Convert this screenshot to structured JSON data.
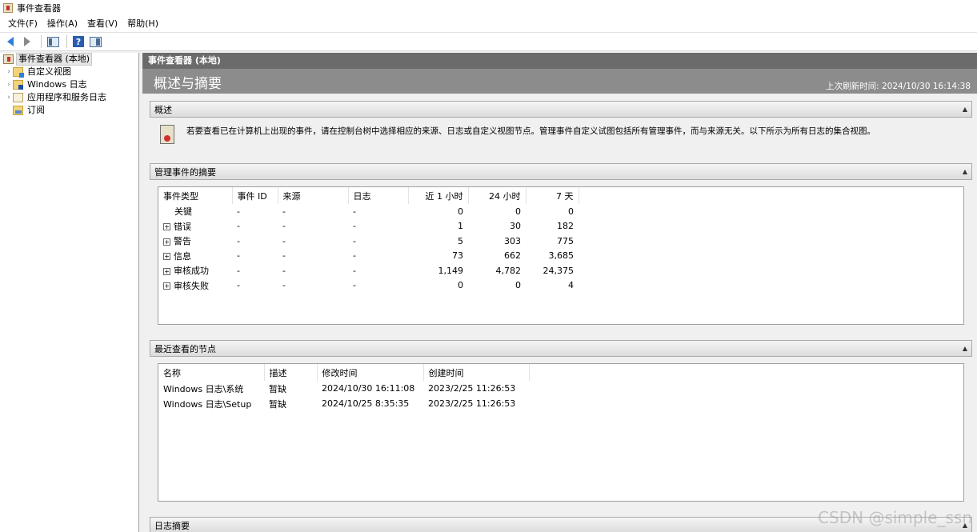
{
  "window": {
    "title": "事件查看器"
  },
  "menu": [
    "文件(F)",
    "操作(A)",
    "查看(V)",
    "帮助(H)"
  ],
  "toolbar": {
    "icons": [
      "back-arrow-icon",
      "forward-arrow-icon",
      "show-hide-tree-icon",
      "help-icon",
      "show-hide-action-pane-icon"
    ]
  },
  "tree": {
    "root": "事件查看器 (本地)",
    "items": [
      {
        "label": "自定义视图",
        "icon": "custom-views-folder-icon"
      },
      {
        "label": "Windows 日志",
        "icon": "windows-logs-folder-icon"
      },
      {
        "label": "应用程序和服务日志",
        "icon": "app-service-logs-icon"
      },
      {
        "label": "订阅",
        "icon": "subscriptions-icon"
      }
    ]
  },
  "main": {
    "header": "事件查看器 (本地)",
    "title": "概述与摘要",
    "last_refresh": "上次刷新时间: 2024/10/30 16:14:38"
  },
  "overview": {
    "title": "概述",
    "text": "若要查看已在计算机上出现的事件，请在控制台树中选择相应的来源、日志或自定义视图节点。管理事件自定义试图包括所有管理事件，而与来源无关。以下所示为所有日志的集合视图。"
  },
  "summary": {
    "title": "管理事件的摘要",
    "columns": [
      "事件类型",
      "事件 ID",
      "来源",
      "日志",
      "近 1 小时",
      "24 小时",
      "7 天"
    ],
    "rows": [
      {
        "type": "关键",
        "id": "-",
        "source": "-",
        "log": "-",
        "h1": "0",
        "h24": "0",
        "d7": "0",
        "expandable": false
      },
      {
        "type": "错误",
        "id": "-",
        "source": "-",
        "log": "-",
        "h1": "1",
        "h24": "30",
        "d7": "182",
        "expandable": true
      },
      {
        "type": "警告",
        "id": "-",
        "source": "-",
        "log": "-",
        "h1": "5",
        "h24": "303",
        "d7": "775",
        "expandable": true
      },
      {
        "type": "信息",
        "id": "-",
        "source": "-",
        "log": "-",
        "h1": "73",
        "h24": "662",
        "d7": "3,685",
        "expandable": true
      },
      {
        "type": "审核成功",
        "id": "-",
        "source": "-",
        "log": "-",
        "h1": "1,149",
        "h24": "4,782",
        "d7": "24,375",
        "expandable": true
      },
      {
        "type": "审核失败",
        "id": "-",
        "source": "-",
        "log": "-",
        "h1": "0",
        "h24": "0",
        "d7": "4",
        "expandable": true
      }
    ]
  },
  "recent": {
    "title": "最近查看的节点",
    "columns": [
      "名称",
      "描述",
      "修改时间",
      "创建时间"
    ],
    "rows": [
      {
        "name": "Windows 日志\\系统",
        "desc": "暂缺",
        "modified": "2024/10/30 16:11:08",
        "created": "2023/2/25 11:26:53"
      },
      {
        "name": "Windows 日志\\Setup",
        "desc": "暂缺",
        "modified": "2024/10/25 8:35:35",
        "created": "2023/2/25 11:26:53"
      }
    ]
  },
  "log_summary": {
    "title": "日志摘要"
  },
  "watermark": "CSDN @simple_ssn"
}
